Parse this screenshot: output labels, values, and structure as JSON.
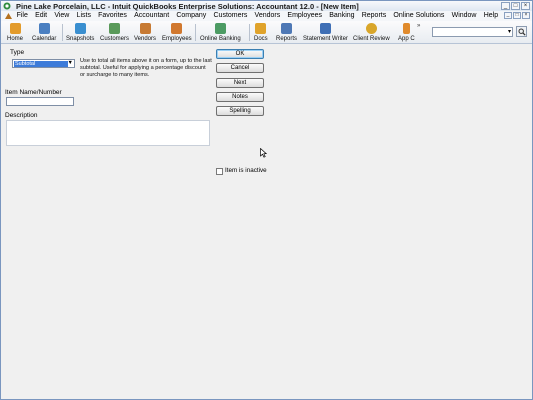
{
  "window": {
    "title": "Pine Lake Porcelain, LLC  - Intuit QuickBooks Enterprise Solutions: Accountant 12.0 - [New Item]",
    "controls": [
      "minimize-icon",
      "maximize-icon",
      "close-icon"
    ]
  },
  "menu": {
    "items": [
      "File",
      "Edit",
      "View",
      "Lists",
      "Favorites",
      "Accountant",
      "Company",
      "Customers",
      "Vendors",
      "Employees",
      "Banking",
      "Reports",
      "Online Solutions",
      "Window",
      "Help"
    ]
  },
  "toolbar": {
    "items": [
      {
        "label": "Home",
        "icon": "home-icon",
        "color": "#e39b2b"
      },
      {
        "label": "Calendar",
        "icon": "calendar-icon",
        "color": "#4a7fc1"
      },
      {
        "label": "Snapshots",
        "icon": "snapshots-icon",
        "color": "#3a8fd0"
      },
      {
        "label": "Customers",
        "icon": "customers-icon",
        "color": "#5a9a5a"
      },
      {
        "label": "Vendors",
        "icon": "vendors-icon",
        "color": "#c77a33"
      },
      {
        "label": "Employees",
        "icon": "employees-icon",
        "color": "#d1782e"
      },
      {
        "label": "Online Banking",
        "icon": "online-banking-icon",
        "color": "#4c9b63"
      },
      {
        "label": "Docs",
        "icon": "docs-icon",
        "color": "#e0a32b"
      },
      {
        "label": "Reports",
        "icon": "reports-icon",
        "color": "#4e78b5"
      },
      {
        "label": "Statement Writer",
        "icon": "statement-writer-icon",
        "color": "#3f6fb5"
      },
      {
        "label": "Client Review",
        "icon": "client-review-icon",
        "color": "#d9a62a"
      },
      {
        "label": "App C",
        "icon": "app-center-icon",
        "color": "#e08a2c"
      }
    ],
    "more": "»"
  },
  "form": {
    "type_label": "Type",
    "type_value": "Subtotal",
    "type_help": "Use to total all items above it on a form, up to the last subtotal. Useful for applying a percentage discount or surcharge to many items.",
    "name_label": "Item Name/Number",
    "name_value": "",
    "description_label": "Description",
    "description_value": "",
    "inactive_label": "Item is inactive"
  },
  "buttons": {
    "ok": "OK",
    "cancel": "Cancel",
    "next": "Next",
    "notes": "Notes",
    "spelling": "Spelling"
  }
}
